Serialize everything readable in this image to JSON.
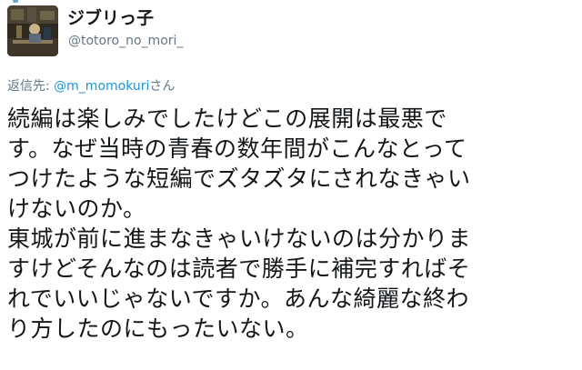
{
  "user": {
    "display_name": "ジブリっ子",
    "handle": "@totoro_no_mori_"
  },
  "reply": {
    "prefix": "返信先: ",
    "mention": "@m_momokuri",
    "suffix": "さん"
  },
  "tweet": {
    "lines": [
      "続編は楽しみでしたけどこの展開は最悪で",
      "す。なぜ当時の青春の数年間がこんなとって",
      "つけたような短編でズタズタにされなきゃい",
      "けないのか。",
      "東城が前に進まなきゃいけないのは分かりま",
      "すけどそんなのは読者で勝手に補完すればそ",
      "れでいいじゃないですか。あんな綺麗な終わ",
      "り方したのにもったいない。"
    ]
  },
  "colors": {
    "name": "#14171a",
    "secondary": "#657786",
    "link": "#1b95e0",
    "text": "#14171a"
  }
}
